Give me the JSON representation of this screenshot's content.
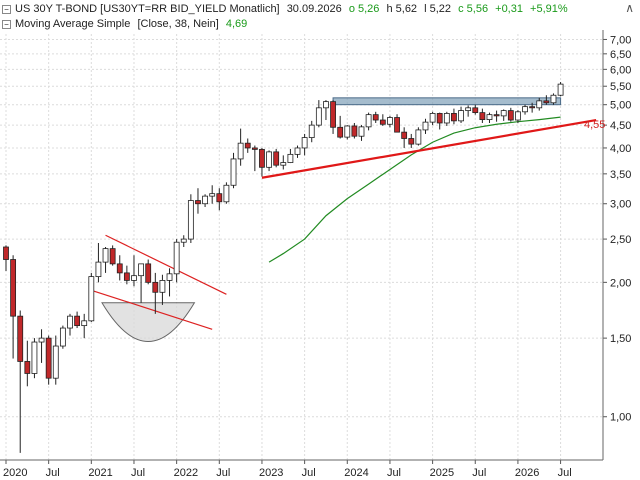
{
  "header": {
    "title": "US 30Y T-BOND [US30YT=RR BID_YIELD Monatlich]",
    "date": "30.09.2026",
    "open": "o 5,26",
    "high": "h 5,62",
    "low": "l 5,22",
    "close": "c 5,56",
    "change": "+0,31",
    "change_pct": "+5,91%",
    "indicator_label": "Moving Average Simple",
    "indicator_params": "[Close, 38, Nein]",
    "indicator_value": "4,69",
    "collapse_symbol": "−",
    "toggle_symbol": "∧"
  },
  "colors": {
    "up": "#ffffff",
    "down": "#c0282a",
    "ma_line": "#228b22",
    "trend_line": "#e01818",
    "channel_line": "#d22",
    "zone_fill": "#7f9fb8",
    "grid": "#dcdcdc",
    "last_label": "#d02020"
  },
  "chart_data": {
    "type": "candlestick",
    "y_scale": "log",
    "ylim": [
      0.8,
      7.2
    ],
    "y_ticks": [
      "7,00",
      "6,50",
      "6,00",
      "5,50",
      "5,00",
      "4,50",
      "4,00",
      "3,50",
      "3,00",
      "2,50",
      "2,00",
      "1,50",
      "1,00"
    ],
    "y_tick_values": [
      7.0,
      6.5,
      6.0,
      5.5,
      5.0,
      4.5,
      4.0,
      3.5,
      3.0,
      2.5,
      2.0,
      1.5,
      1.0
    ],
    "x_labels": [
      {
        "label": "2020",
        "idx": 0
      },
      {
        "label": "Jul",
        "idx": 6
      },
      {
        "label": "2021",
        "idx": 12
      },
      {
        "label": "Jul",
        "idx": 18
      },
      {
        "label": "2022",
        "idx": 24
      },
      {
        "label": "Jul",
        "idx": 30
      },
      {
        "label": "2023",
        "idx": 36
      },
      {
        "label": "Jul",
        "idx": 42
      },
      {
        "label": "2024",
        "idx": 48
      },
      {
        "label": "Jul",
        "idx": 54
      },
      {
        "label": "2025",
        "idx": 60
      },
      {
        "label": "Jul",
        "idx": 66
      },
      {
        "label": "2026",
        "idx": 72
      },
      {
        "label": "Jul",
        "idx": 78
      }
    ],
    "candles": [
      [
        2.4,
        2.42,
        2.12,
        2.25
      ],
      [
        2.25,
        2.3,
        1.35,
        1.68
      ],
      [
        1.68,
        1.73,
        0.83,
        1.33
      ],
      [
        1.33,
        1.48,
        1.17,
        1.25
      ],
      [
        1.25,
        1.5,
        1.22,
        1.47
      ],
      [
        1.47,
        1.57,
        1.32,
        1.5
      ],
      [
        1.5,
        1.52,
        1.18,
        1.22
      ],
      [
        1.22,
        1.52,
        1.18,
        1.44
      ],
      [
        1.44,
        1.6,
        1.42,
        1.58
      ],
      [
        1.58,
        1.7,
        1.52,
        1.68
      ],
      [
        1.68,
        1.72,
        1.58,
        1.6
      ],
      [
        1.6,
        1.7,
        1.5,
        1.64
      ],
      [
        1.64,
        2.1,
        1.63,
        2.06
      ],
      [
        2.06,
        2.45,
        2.0,
        2.22
      ],
      [
        2.22,
        2.4,
        2.1,
        2.38
      ],
      [
        2.38,
        2.42,
        2.18,
        2.2
      ],
      [
        2.2,
        2.3,
        2.02,
        2.1
      ],
      [
        2.1,
        2.18,
        1.98,
        2.02
      ],
      [
        2.02,
        2.3,
        1.96,
        2.07
      ],
      [
        2.07,
        2.15,
        1.8,
        2.2
      ],
      [
        2.2,
        2.25,
        1.98,
        2.0
      ],
      [
        2.0,
        2.1,
        1.7,
        1.9
      ],
      [
        1.9,
        2.08,
        1.78,
        2.02
      ],
      [
        2.02,
        2.15,
        1.86,
        2.09
      ],
      [
        2.09,
        2.5,
        2.0,
        2.46
      ],
      [
        2.46,
        2.55,
        2.4,
        2.5
      ],
      [
        2.5,
        3.15,
        2.45,
        3.05
      ],
      [
        3.05,
        3.25,
        2.85,
        3.0
      ],
      [
        3.0,
        3.15,
        2.95,
        3.12
      ],
      [
        3.12,
        3.3,
        3.0,
        3.16
      ],
      [
        3.16,
        3.25,
        2.9,
        3.03
      ],
      [
        3.03,
        3.35,
        3.0,
        3.3
      ],
      [
        3.3,
        3.9,
        3.25,
        3.78
      ],
      [
        3.78,
        4.42,
        3.65,
        4.1
      ],
      [
        4.1,
        4.2,
        3.9,
        4.0
      ],
      [
        4.0,
        4.05,
        3.55,
        3.97
      ],
      [
        3.97,
        4.0,
        3.45,
        3.62
      ],
      [
        3.62,
        3.95,
        3.55,
        3.92
      ],
      [
        3.92,
        3.98,
        3.62,
        3.66
      ],
      [
        3.66,
        3.85,
        3.58,
        3.71
      ],
      [
        3.71,
        3.98,
        3.7,
        3.87
      ],
      [
        3.87,
        4.05,
        3.8,
        4.0
      ],
      [
        4.0,
        4.3,
        3.85,
        4.22
      ],
      [
        4.22,
        4.6,
        4.12,
        4.5
      ],
      [
        4.5,
        5.12,
        4.45,
        4.92
      ],
      [
        4.92,
        5.12,
        4.62,
        5.08
      ],
      [
        5.08,
        5.12,
        4.3,
        4.45
      ],
      [
        4.45,
        4.72,
        4.2,
        4.23
      ],
      [
        4.23,
        4.5,
        4.18,
        4.48
      ],
      [
        4.48,
        4.55,
        4.2,
        4.25
      ],
      [
        4.25,
        4.5,
        4.15,
        4.46
      ],
      [
        4.46,
        4.8,
        4.38,
        4.75
      ],
      [
        4.75,
        4.82,
        4.55,
        4.62
      ],
      [
        4.62,
        4.76,
        4.48,
        4.52
      ],
      [
        4.52,
        4.72,
        4.45,
        4.68
      ],
      [
        4.68,
        4.76,
        4.35,
        4.34
      ],
      [
        4.34,
        4.45,
        4.0,
        4.2
      ],
      [
        4.2,
        4.3,
        4.0,
        4.08
      ],
      [
        4.08,
        4.45,
        4.05,
        4.39
      ],
      [
        4.39,
        4.65,
        4.3,
        4.57
      ],
      [
        4.57,
        4.82,
        4.5,
        4.78
      ],
      [
        4.78,
        4.8,
        4.4,
        4.55
      ],
      [
        4.55,
        4.82,
        4.48,
        4.78
      ],
      [
        4.78,
        4.9,
        4.52,
        4.6
      ],
      [
        4.6,
        4.95,
        4.55,
        4.85
      ],
      [
        4.85,
        4.98,
        4.7,
        4.92
      ],
      [
        4.92,
        5.0,
        4.75,
        4.8
      ],
      [
        4.8,
        4.9,
        4.55,
        4.63
      ],
      [
        4.63,
        4.8,
        4.55,
        4.75
      ],
      [
        4.75,
        4.85,
        4.58,
        4.72
      ],
      [
        4.72,
        4.88,
        4.6,
        4.85
      ],
      [
        4.85,
        4.92,
        4.58,
        4.62
      ],
      [
        4.62,
        4.86,
        4.55,
        4.82
      ],
      [
        4.82,
        5.0,
        4.75,
        4.95
      ],
      [
        4.95,
        5.05,
        4.8,
        4.92
      ],
      [
        4.92,
        5.18,
        4.85,
        5.1
      ],
      [
        5.1,
        5.25,
        5.0,
        5.05
      ],
      [
        5.05,
        5.3,
        5.0,
        5.25
      ],
      [
        5.25,
        5.62,
        5.22,
        5.56
      ]
    ],
    "moving_average": {
      "name": "Moving Average Simple",
      "points": [
        [
          37,
          2.22
        ],
        [
          39,
          2.32
        ],
        [
          42,
          2.5
        ],
        [
          45,
          2.82
        ],
        [
          48,
          3.08
        ],
        [
          51,
          3.32
        ],
        [
          54,
          3.58
        ],
        [
          57,
          3.86
        ],
        [
          60,
          4.12
        ],
        [
          63,
          4.32
        ],
        [
          66,
          4.44
        ],
        [
          69,
          4.52
        ],
        [
          72,
          4.58
        ],
        [
          75,
          4.63
        ],
        [
          78,
          4.69
        ]
      ]
    },
    "annotations": {
      "resistance_zone": {
        "from_idx": 46,
        "to_idx": 78,
        "low": 5.0,
        "high": 5.18
      },
      "trend_line": {
        "start": [
          36,
          3.43
        ],
        "end": [
          83,
          4.62
        ],
        "label": "4,55",
        "label_value": 4.55
      },
      "channel_upper": {
        "start": [
          14,
          2.55
        ],
        "end": [
          31,
          1.88
        ]
      },
      "channel_lower": {
        "start": [
          12,
          1.92
        ],
        "end": [
          29,
          1.57
        ]
      },
      "rounding_bottom": {
        "center_idx": 20,
        "top_value": 1.8,
        "bottom_value": 1.45,
        "half_width_idx": 6.5
      }
    }
  }
}
